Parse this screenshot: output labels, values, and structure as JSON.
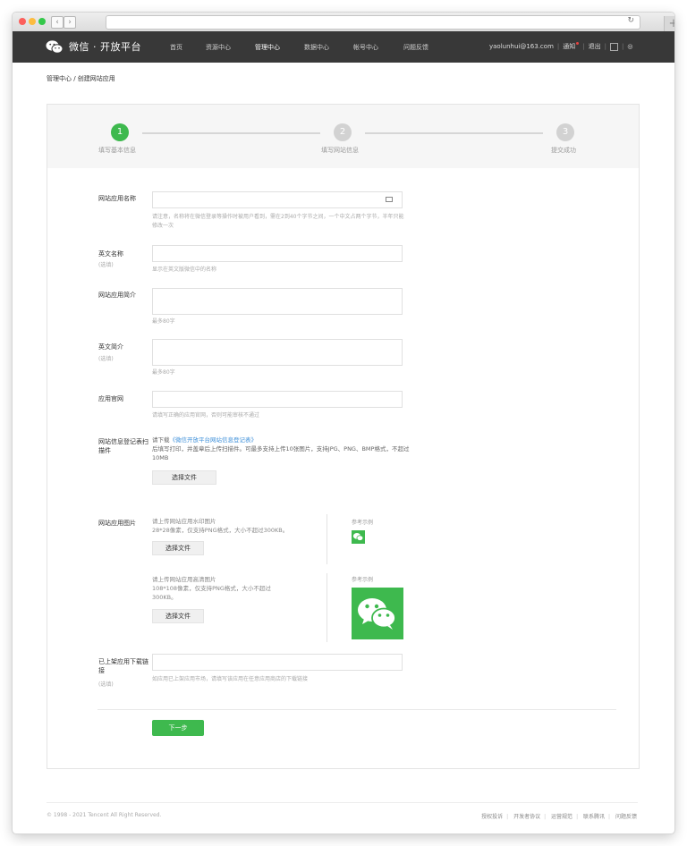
{
  "site": {
    "name": "微信 · 开放平台"
  },
  "nav": {
    "items": [
      "首页",
      "资源中心",
      "管理中心",
      "数据中心",
      "帐号中心",
      "问题反馈"
    ],
    "active": "管理中心"
  },
  "user": {
    "email": "yaolunhui@163.com",
    "notice": "通知",
    "logout": "退出"
  },
  "breadcrumb": "管理中心 / 创建网站应用",
  "steps": [
    {
      "num": "1",
      "label": "填写基本信息",
      "state": "active"
    },
    {
      "num": "2",
      "label": "填写网站信息",
      "state": "pending"
    },
    {
      "num": "3",
      "label": "提交成功",
      "state": "pending"
    }
  ],
  "form": {
    "app_name": {
      "label": "网站应用名称",
      "value": "",
      "hint": "请注意，名称将在微信登录等操作时被用户看到，需在2到40个字节之间，一个中文占两个字节，半年只能修改一次"
    },
    "en_name": {
      "label": "英文名称",
      "optional": "(选填)",
      "value": "",
      "hint": "显示在英文版微信中的名称"
    },
    "desc": {
      "label": "网站应用简介",
      "value": "",
      "hint": "最多80字"
    },
    "en_desc": {
      "label": "英文简介",
      "optional": "(选填)",
      "value": "",
      "hint": "最多80字"
    },
    "website": {
      "label": "应用官网",
      "value": "",
      "hint": "请填写正确的应用官网，否则可能审核不通过"
    },
    "reg_form": {
      "label": "网站信息登记表扫描件",
      "prefix": "请下载",
      "link": "《微信开放平台网站信息登记表》",
      "hint": "后填写打印，并盖章后上传扫描件。可最多支持上传10张图片，支持JPG、PNG、BMP格式，不超过10MB",
      "button": "选择文件"
    },
    "images": {
      "label": "网站应用图片",
      "small": {
        "title": "请上传网站应用水印图片",
        "spec": "28*28像素，仅支持PNG格式，大小不超过300KB。",
        "button": "选择文件",
        "ref": "参考示例"
      },
      "large": {
        "title": "请上传网站应用高清图片",
        "spec": "108*108像素，仅支持PNG格式，大小不超过300KB。",
        "button": "选择文件",
        "ref": "参考示例"
      }
    },
    "download": {
      "label": "已上架应用下载链接",
      "optional": "(选填)",
      "value": "",
      "hint": "如应用已上架应用市场，请填写该应用在任意应用商店的下载链接"
    },
    "next": "下一步"
  },
  "footer": {
    "copyright": "© 1998 - 2021 Tencent All Right Reserved.",
    "links": [
      "授权投诉",
      "开发者协议",
      "运营规范",
      "联系腾讯",
      "问题反馈"
    ]
  },
  "colors": {
    "brand_green": "#3eb94e",
    "nav_bg": "#383838"
  }
}
